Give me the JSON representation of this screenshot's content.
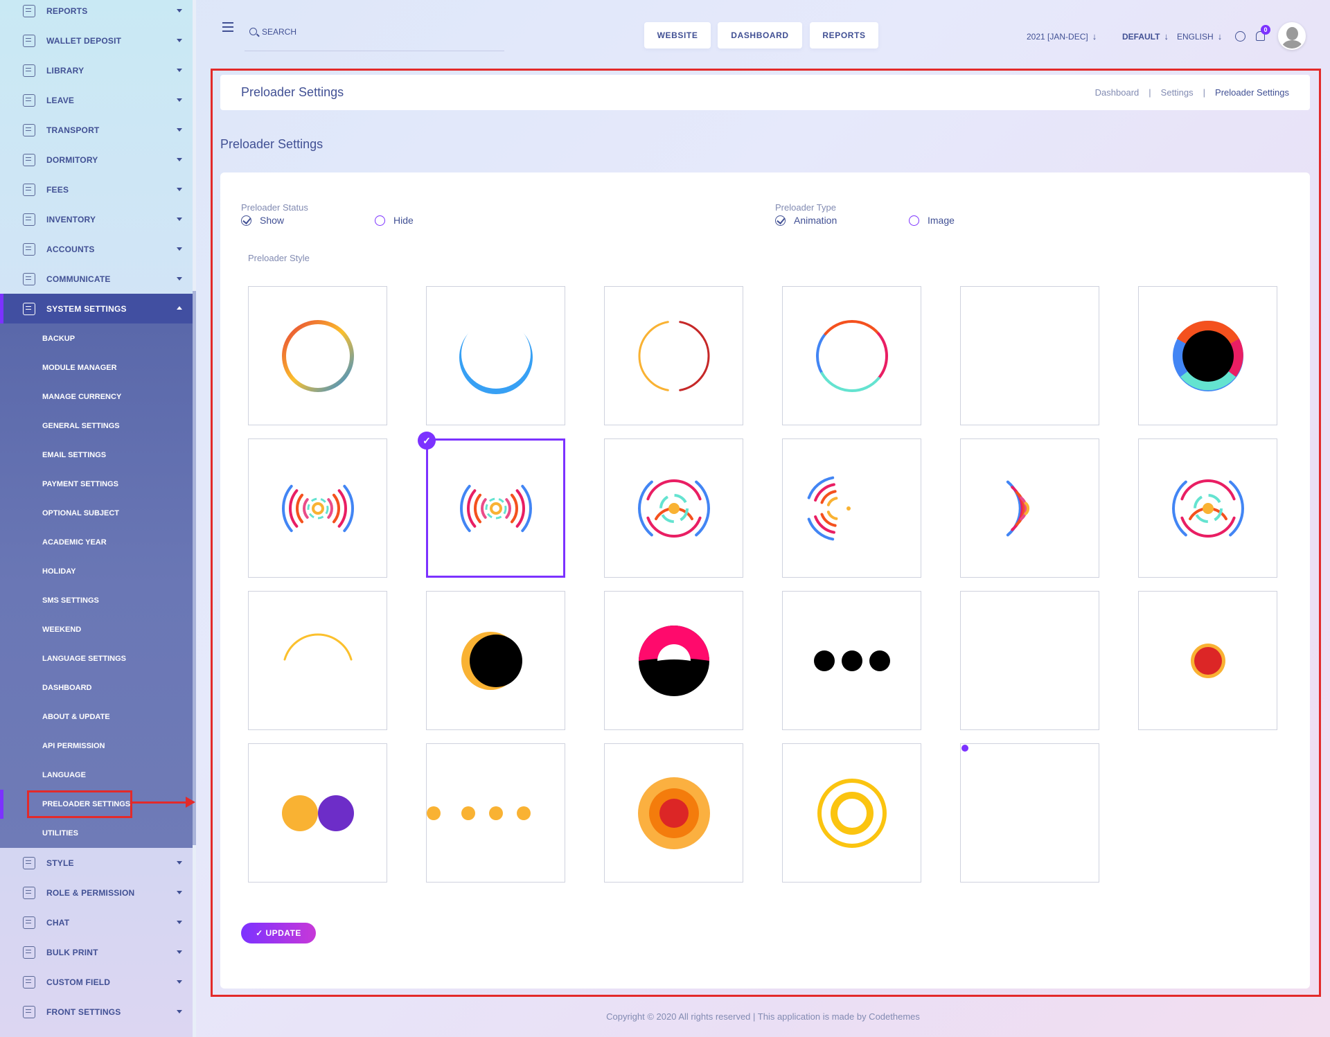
{
  "sidebar": {
    "menu_top": [
      {
        "label": "REPORTS",
        "icon": "reports-icon"
      },
      {
        "label": "WALLET DEPOSIT",
        "icon": "wallet-icon"
      },
      {
        "label": "LIBRARY",
        "icon": "library-icon"
      },
      {
        "label": "LEAVE",
        "icon": "leave-icon"
      },
      {
        "label": "TRANSPORT",
        "icon": "transport-icon"
      },
      {
        "label": "DORMITORY",
        "icon": "dormitory-icon"
      },
      {
        "label": "FEES",
        "icon": "fees-icon"
      },
      {
        "label": "INVENTORY",
        "icon": "inventory-icon"
      },
      {
        "label": "ACCOUNTS",
        "icon": "accounts-icon"
      },
      {
        "label": "COMMUNICATE",
        "icon": "communicate-icon"
      },
      {
        "label": "SYSTEM SETTINGS",
        "icon": "settings-icon"
      }
    ],
    "submenu": [
      "BACKUP",
      "MODULE MANAGER",
      "MANAGE CURRENCY",
      "GENERAL SETTINGS",
      "EMAIL SETTINGS",
      "PAYMENT SETTINGS",
      "OPTIONAL SUBJECT",
      "ACADEMIC YEAR",
      "HOLIDAY",
      "SMS SETTINGS",
      "WEEKEND",
      "LANGUAGE SETTINGS",
      "DASHBOARD",
      "ABOUT & UPDATE",
      "API PERMISSION",
      "LANGUAGE",
      "PRELOADER SETTINGS",
      "UTILITIES"
    ],
    "menu_bottom": [
      {
        "label": "STYLE",
        "icon": "style-icon"
      },
      {
        "label": "ROLE & PERMISSION",
        "icon": "role-icon"
      },
      {
        "label": "CHAT",
        "icon": "chat-icon"
      },
      {
        "label": "BULK PRINT",
        "icon": "print-icon"
      },
      {
        "label": "CUSTOM FIELD",
        "icon": "custom-field-icon"
      },
      {
        "label": "FRONT SETTINGS",
        "icon": "front-settings-icon"
      }
    ]
  },
  "topbar": {
    "search_placeholder": "SEARCH",
    "buttons": [
      "WEBSITE",
      "DASHBOARD",
      "REPORTS"
    ],
    "year": "2021 [JAN-DEC]",
    "theme": "DEFAULT",
    "language": "ENGLISH",
    "notification_count": "0"
  },
  "header": {
    "title": "Preloader Settings",
    "breadcrumb": [
      "Dashboard",
      "Settings",
      "Preloader Settings"
    ]
  },
  "section_title": "Preloader Settings",
  "form": {
    "status_label": "Preloader Status",
    "status_options": [
      "Show",
      "Hide"
    ],
    "status_selected": "Show",
    "type_label": "Preloader Type",
    "type_options": [
      "Animation",
      "Image"
    ],
    "type_selected": "Animation",
    "style_label": "Preloader Style",
    "selected_style": 8,
    "update_label": "✓ UPDATE"
  },
  "colors": {
    "primary": "#7c32ff",
    "sidebar_active": "#414fa1",
    "highlight_red": "#e32a2a",
    "text": "#415094"
  },
  "footer": "Copyright © 2020 All rights reserved | This application is made by Codethemes"
}
